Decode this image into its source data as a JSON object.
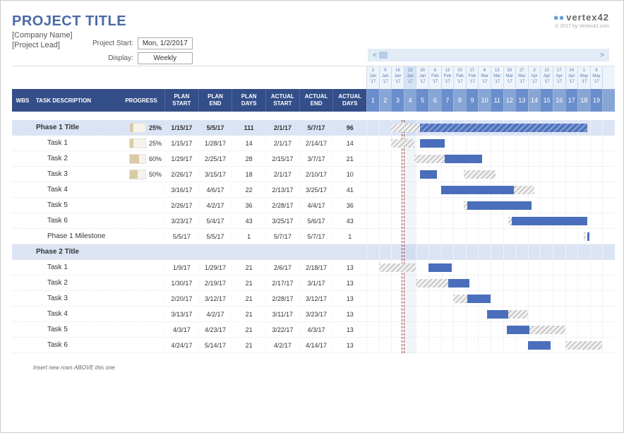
{
  "header": {
    "title": "PROJECT TITLE",
    "company": "[Company Name]",
    "lead": "[Project Lead]",
    "meta": {
      "start_label": "Project Start:",
      "start_value": "Mon, 1/2/2017",
      "display_label": "Display:",
      "display_value": "Weekly"
    },
    "logo": {
      "mark": "●●",
      "text": "vertex",
      "suffix": "42"
    },
    "copyright": "© 2017 by Vertex42.com"
  },
  "columns": {
    "wbs": "WBS",
    "desc": "TASK DESCRIPTION",
    "prog": "PROGRESS",
    "plan_start": "PLAN\nSTART",
    "plan_end": "PLAN\nEND",
    "plan_days": "PLAN\nDAYS",
    "actual_start": "ACTUAL\nSTART",
    "actual_end": "ACTUAL\nEND",
    "actual_days": "ACTUAL\nDAYS"
  },
  "footer_note": "Insert new rows ABOVE this one",
  "chart_data": {
    "type": "gantt",
    "timeline_start": "2017-01-02",
    "week_labels": [
      {
        "day": "2",
        "mon": "Jan",
        "yr": "'17",
        "wk": "1"
      },
      {
        "day": "9",
        "mon": "Jan",
        "yr": "'17",
        "wk": "2"
      },
      {
        "day": "16",
        "mon": "Jan",
        "yr": "'17",
        "wk": "3"
      },
      {
        "day": "23",
        "mon": "Jan",
        "yr": "'17",
        "wk": "4",
        "today": true
      },
      {
        "day": "30",
        "mon": "Jan",
        "yr": "'17",
        "wk": "5"
      },
      {
        "day": "6",
        "mon": "Feb",
        "yr": "'17",
        "wk": "6"
      },
      {
        "day": "13",
        "mon": "Feb",
        "yr": "'17",
        "wk": "7"
      },
      {
        "day": "20",
        "mon": "Feb",
        "yr": "'17",
        "wk": "8"
      },
      {
        "day": "27",
        "mon": "Feb",
        "yr": "'17",
        "wk": "9"
      },
      {
        "day": "6",
        "mon": "Mar",
        "yr": "'17",
        "wk": "10"
      },
      {
        "day": "13",
        "mon": "Mar",
        "yr": "'17",
        "wk": "11"
      },
      {
        "day": "20",
        "mon": "Mar",
        "yr": "'17",
        "wk": "12"
      },
      {
        "day": "27",
        "mon": "Mar",
        "yr": "'17",
        "wk": "13"
      },
      {
        "day": "3",
        "mon": "Apr",
        "yr": "'17",
        "wk": "14"
      },
      {
        "day": "10",
        "mon": "Apr",
        "yr": "'17",
        "wk": "15"
      },
      {
        "day": "17",
        "mon": "Apr",
        "yr": "'17",
        "wk": "16"
      },
      {
        "day": "24",
        "mon": "Apr",
        "yr": "'17",
        "wk": "17"
      },
      {
        "day": "1",
        "mon": "May",
        "yr": "'17",
        "wk": "18"
      },
      {
        "day": "8",
        "mon": "May",
        "yr": "'17",
        "wk": "19"
      },
      {
        "day": "",
        "mon": "",
        "yr": "",
        "wk": ""
      }
    ],
    "tasks": [
      {
        "kind": "phase",
        "name": "Phase 1 Title",
        "progress": 25,
        "plan_start": "1/15/17",
        "plan_end": "5/5/17",
        "plan_days": 111,
        "actual_start": "2/1/17",
        "actual_end": "5/7/17",
        "actual_days": 96,
        "p_s": 2,
        "p_e": 17.5,
        "a_s": 4.3,
        "a_e": 17.8
      },
      {
        "kind": "task",
        "name": "Task 1",
        "progress": 25,
        "plan_start": "1/15/17",
        "plan_end": "1/28/17",
        "plan_days": 14,
        "actual_start": "2/1/17",
        "actual_end": "2/14/17",
        "actual_days": 14,
        "p_s": 2,
        "p_e": 3.85,
        "a_s": 4.3,
        "a_e": 6.3
      },
      {
        "kind": "task",
        "name": "Task 2",
        "progress": 60,
        "plan_start": "1/29/17",
        "plan_end": "2/25/17",
        "plan_days": 28,
        "actual_start": "2/15/17",
        "actual_end": "3/7/17",
        "actual_days": 21,
        "p_s": 3.85,
        "p_e": 7.85,
        "a_s": 6.3,
        "a_e": 9.3
      },
      {
        "kind": "task",
        "name": "Task 3",
        "progress": 50,
        "plan_start": "2/26/17",
        "plan_end": "3/15/17",
        "plan_days": 18,
        "actual_start": "2/1/17",
        "actual_end": "2/10/17",
        "actual_days": 10,
        "p_s": 7.85,
        "p_e": 10.4,
        "a_s": 4.3,
        "a_e": 5.7
      },
      {
        "kind": "task",
        "name": "Task 4",
        "progress": null,
        "plan_start": "3/16/17",
        "plan_end": "4/6/17",
        "plan_days": 22,
        "actual_start": "2/13/17",
        "actual_end": "3/25/17",
        "actual_days": 41,
        "p_s": 10.4,
        "p_e": 13.5,
        "a_s": 6,
        "a_e": 11.85
      },
      {
        "kind": "task",
        "name": "Task 5",
        "progress": null,
        "plan_start": "2/26/17",
        "plan_end": "4/2/17",
        "plan_days": 36,
        "actual_start": "2/28/17",
        "actual_end": "4/4/17",
        "actual_days": 36,
        "p_s": 7.85,
        "p_e": 13,
        "a_s": 8.15,
        "a_e": 13.3
      },
      {
        "kind": "task",
        "name": "Task 6",
        "progress": null,
        "plan_start": "3/23/17",
        "plan_end": "5/4/17",
        "plan_days": 43,
        "actual_start": "3/25/17",
        "actual_end": "5/6/17",
        "actual_days": 43,
        "p_s": 11.4,
        "p_e": 17.5,
        "a_s": 11.7,
        "a_e": 17.8
      },
      {
        "kind": "ms",
        "name": "Phase 1 Milestone",
        "progress": null,
        "plan_start": "5/5/17",
        "plan_end": "5/5/17",
        "plan_days": 1,
        "actual_start": "5/7/17",
        "actual_end": "5/7/17",
        "actual_days": 1,
        "p_s": 17.5,
        "p_e": 17.65,
        "a_s": 17.8,
        "a_e": 17.95
      },
      {
        "kind": "phase",
        "name": "Phase 2 Title",
        "progress": null,
        "plan_start": "",
        "plan_end": "",
        "plan_days": "",
        "actual_start": "",
        "actual_end": "",
        "actual_days": ""
      },
      {
        "kind": "task",
        "name": "Task 1",
        "progress": null,
        "plan_start": "1/9/17",
        "plan_end": "1/29/17",
        "plan_days": 21,
        "actual_start": "2/6/17",
        "actual_end": "2/18/17",
        "actual_days": 13,
        "p_s": 1,
        "p_e": 4,
        "a_s": 5,
        "a_e": 6.85
      },
      {
        "kind": "task",
        "name": "Task 2",
        "progress": null,
        "plan_start": "1/30/17",
        "plan_end": "2/19/17",
        "plan_days": 21,
        "actual_start": "2/17/17",
        "actual_end": "3/1/17",
        "actual_days": 13,
        "p_s": 4,
        "p_e": 7,
        "a_s": 6.6,
        "a_e": 8.3
      },
      {
        "kind": "task",
        "name": "Task 3",
        "progress": null,
        "plan_start": "2/20/17",
        "plan_end": "3/12/17",
        "plan_days": 21,
        "actual_start": "2/28/17",
        "actual_end": "3/12/17",
        "actual_days": 13,
        "p_s": 7,
        "p_e": 10,
        "a_s": 8.15,
        "a_e": 10
      },
      {
        "kind": "task",
        "name": "Task 4",
        "progress": null,
        "plan_start": "3/13/17",
        "plan_end": "4/2/17",
        "plan_days": 21,
        "actual_start": "3/11/17",
        "actual_end": "3/23/17",
        "actual_days": 13,
        "p_s": 10,
        "p_e": 13,
        "a_s": 9.7,
        "a_e": 11.4
      },
      {
        "kind": "task",
        "name": "Task 5",
        "progress": null,
        "plan_start": "4/3/17",
        "plan_end": "4/23/17",
        "plan_days": 21,
        "actual_start": "3/22/17",
        "actual_end": "4/3/17",
        "actual_days": 13,
        "p_s": 13,
        "p_e": 16,
        "a_s": 11.3,
        "a_e": 13.15
      },
      {
        "kind": "task",
        "name": "Task 6",
        "progress": null,
        "plan_start": "4/24/17",
        "plan_end": "5/14/17",
        "plan_days": 21,
        "actual_start": "4/2/17",
        "actual_end": "4/14/17",
        "actual_days": 13,
        "p_s": 16,
        "p_e": 19,
        "a_s": 13,
        "a_e": 14.85
      }
    ]
  }
}
